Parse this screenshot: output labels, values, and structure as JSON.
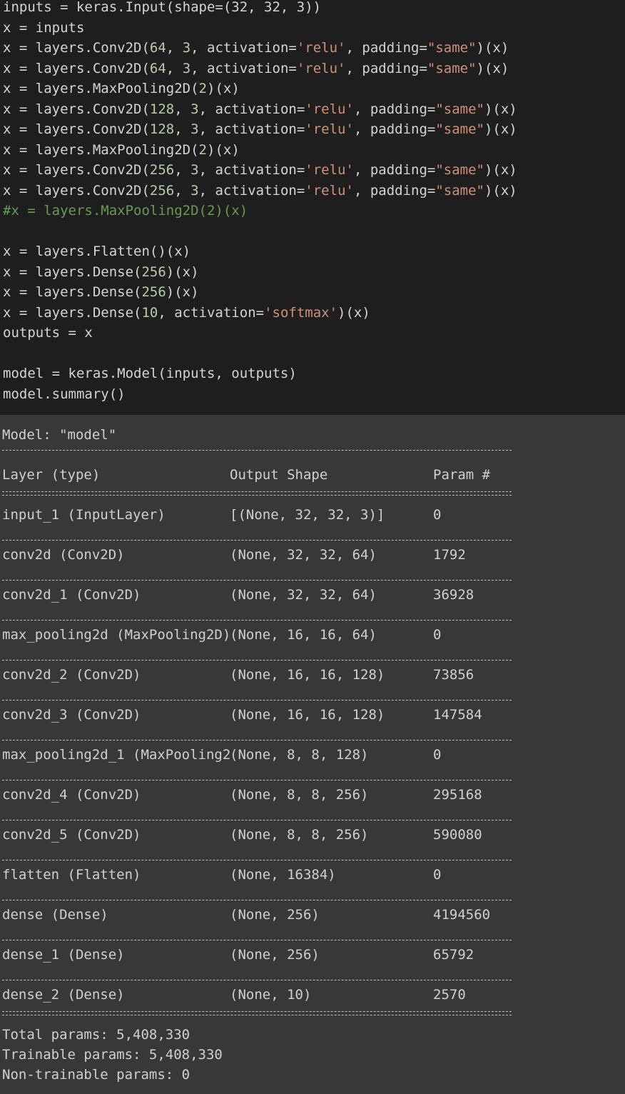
{
  "code": {
    "lines": [
      [
        {
          "t": "inputs = keras.Input(shape=(32, 32, 3))",
          "c": ""
        }
      ],
      [
        {
          "t": "x = inputs",
          "c": ""
        }
      ],
      [
        {
          "t": "x = layers.Conv2D(",
          "c": ""
        },
        {
          "t": "64",
          "c": "num"
        },
        {
          "t": ", ",
          "c": ""
        },
        {
          "t": "3",
          "c": "num"
        },
        {
          "t": ", activation=",
          "c": ""
        },
        {
          "t": "'relu'",
          "c": "str"
        },
        {
          "t": ", padding=",
          "c": ""
        },
        {
          "t": "\"same\"",
          "c": "str"
        },
        {
          "t": ")(x)",
          "c": ""
        }
      ],
      [
        {
          "t": "x = layers.Conv2D(",
          "c": ""
        },
        {
          "t": "64",
          "c": "num"
        },
        {
          "t": ", ",
          "c": ""
        },
        {
          "t": "3",
          "c": "num"
        },
        {
          "t": ", activation=",
          "c": ""
        },
        {
          "t": "'relu'",
          "c": "str"
        },
        {
          "t": ", padding=",
          "c": ""
        },
        {
          "t": "\"same\"",
          "c": "str"
        },
        {
          "t": ")(x)",
          "c": ""
        }
      ],
      [
        {
          "t": "x = layers.MaxPooling2D(",
          "c": ""
        },
        {
          "t": "2",
          "c": "num"
        },
        {
          "t": ")(x)",
          "c": ""
        }
      ],
      [
        {
          "t": "x = layers.Conv2D(",
          "c": ""
        },
        {
          "t": "128",
          "c": "num"
        },
        {
          "t": ", ",
          "c": ""
        },
        {
          "t": "3",
          "c": "num"
        },
        {
          "t": ", activation=",
          "c": ""
        },
        {
          "t": "'relu'",
          "c": "str"
        },
        {
          "t": ", padding=",
          "c": ""
        },
        {
          "t": "\"same\"",
          "c": "str"
        },
        {
          "t": ")(x)",
          "c": ""
        }
      ],
      [
        {
          "t": "x = layers.Conv2D(",
          "c": ""
        },
        {
          "t": "128",
          "c": "num"
        },
        {
          "t": ", ",
          "c": ""
        },
        {
          "t": "3",
          "c": "num"
        },
        {
          "t": ", activation=",
          "c": ""
        },
        {
          "t": "'relu'",
          "c": "str"
        },
        {
          "t": ", padding=",
          "c": ""
        },
        {
          "t": "\"same\"",
          "c": "str"
        },
        {
          "t": ")(x)",
          "c": ""
        }
      ],
      [
        {
          "t": "x = layers.MaxPooling2D(",
          "c": ""
        },
        {
          "t": "2",
          "c": "num"
        },
        {
          "t": ")(x)",
          "c": ""
        }
      ],
      [
        {
          "t": "x = layers.Conv2D(",
          "c": ""
        },
        {
          "t": "256",
          "c": "num"
        },
        {
          "t": ", ",
          "c": ""
        },
        {
          "t": "3",
          "c": "num"
        },
        {
          "t": ", activation=",
          "c": ""
        },
        {
          "t": "'relu'",
          "c": "str"
        },
        {
          "t": ", padding=",
          "c": ""
        },
        {
          "t": "\"same\"",
          "c": "str"
        },
        {
          "t": ")(x)",
          "c": ""
        }
      ],
      [
        {
          "t": "x = layers.Conv2D(",
          "c": ""
        },
        {
          "t": "256",
          "c": "num"
        },
        {
          "t": ", ",
          "c": ""
        },
        {
          "t": "3",
          "c": "num"
        },
        {
          "t": ", activation=",
          "c": ""
        },
        {
          "t": "'relu'",
          "c": "str"
        },
        {
          "t": ", padding=",
          "c": ""
        },
        {
          "t": "\"same\"",
          "c": "str"
        },
        {
          "t": ")(x)",
          "c": ""
        }
      ],
      [
        {
          "t": "#x = layers.MaxPooling2D(2)(x)",
          "c": "comment"
        }
      ],
      [
        {
          "t": "",
          "c": ""
        }
      ],
      [
        {
          "t": "x = layers.Flatten()(x)",
          "c": ""
        }
      ],
      [
        {
          "t": "x = layers.Dense(",
          "c": ""
        },
        {
          "t": "256",
          "c": "num"
        },
        {
          "t": ")(x)",
          "c": ""
        }
      ],
      [
        {
          "t": "x = layers.Dense(",
          "c": ""
        },
        {
          "t": "256",
          "c": "num"
        },
        {
          "t": ")(x)",
          "c": ""
        }
      ],
      [
        {
          "t": "x = layers.Dense(",
          "c": ""
        },
        {
          "t": "10",
          "c": "num"
        },
        {
          "t": ", activation=",
          "c": ""
        },
        {
          "t": "'softmax'",
          "c": "str"
        },
        {
          "t": ")(x)",
          "c": ""
        }
      ],
      [
        {
          "t": "outputs = x",
          "c": ""
        }
      ],
      [
        {
          "t": "",
          "c": ""
        }
      ],
      [
        {
          "t": "model = keras.Model(inputs, outputs)",
          "c": ""
        }
      ],
      [
        {
          "t": "model.summary()",
          "c": ""
        }
      ]
    ]
  },
  "output": {
    "model_label": "Model: \"model\"",
    "headers": {
      "layer": "Layer (type)",
      "shape": "Output Shape",
      "params": "Param #"
    },
    "rows": [
      {
        "layer": "input_1 (InputLayer)",
        "shape": "[(None, 32, 32, 3)]",
        "params": "0"
      },
      {
        "layer": "conv2d (Conv2D)",
        "shape": "(None, 32, 32, 64)",
        "params": "1792"
      },
      {
        "layer": "conv2d_1 (Conv2D)",
        "shape": "(None, 32, 32, 64)",
        "params": "36928"
      },
      {
        "layer": "max_pooling2d (MaxPooling2D)",
        "shape": "(None, 16, 16, 64)",
        "params": "0"
      },
      {
        "layer": "conv2d_2 (Conv2D)",
        "shape": "(None, 16, 16, 128)",
        "params": "73856"
      },
      {
        "layer": "conv2d_3 (Conv2D)",
        "shape": "(None, 16, 16, 128)",
        "params": "147584"
      },
      {
        "layer": "max_pooling2d_1 (MaxPooling2",
        "shape": "(None, 8, 8, 128)",
        "params": "0"
      },
      {
        "layer": "conv2d_4 (Conv2D)",
        "shape": "(None, 8, 8, 256)",
        "params": "295168"
      },
      {
        "layer": "conv2d_5 (Conv2D)",
        "shape": "(None, 8, 8, 256)",
        "params": "590080"
      },
      {
        "layer": "flatten (Flatten)",
        "shape": "(None, 16384)",
        "params": "0"
      },
      {
        "layer": "dense (Dense)",
        "shape": "(None, 256)",
        "params": "4194560"
      },
      {
        "layer": "dense_1 (Dense)",
        "shape": "(None, 256)",
        "params": "65792"
      },
      {
        "layer": "dense_2 (Dense)",
        "shape": "(None, 10)",
        "params": "2570"
      }
    ],
    "total_params": "Total params: 5,408,330",
    "trainable_params": "Trainable params: 5,408,330",
    "non_trainable_params": "Non-trainable params: 0"
  },
  "colors": {
    "code_bg": "#1e1e1e",
    "output_bg": "#383838",
    "string": "#ce9178",
    "number": "#b5cea8",
    "comment": "#6a9955"
  }
}
